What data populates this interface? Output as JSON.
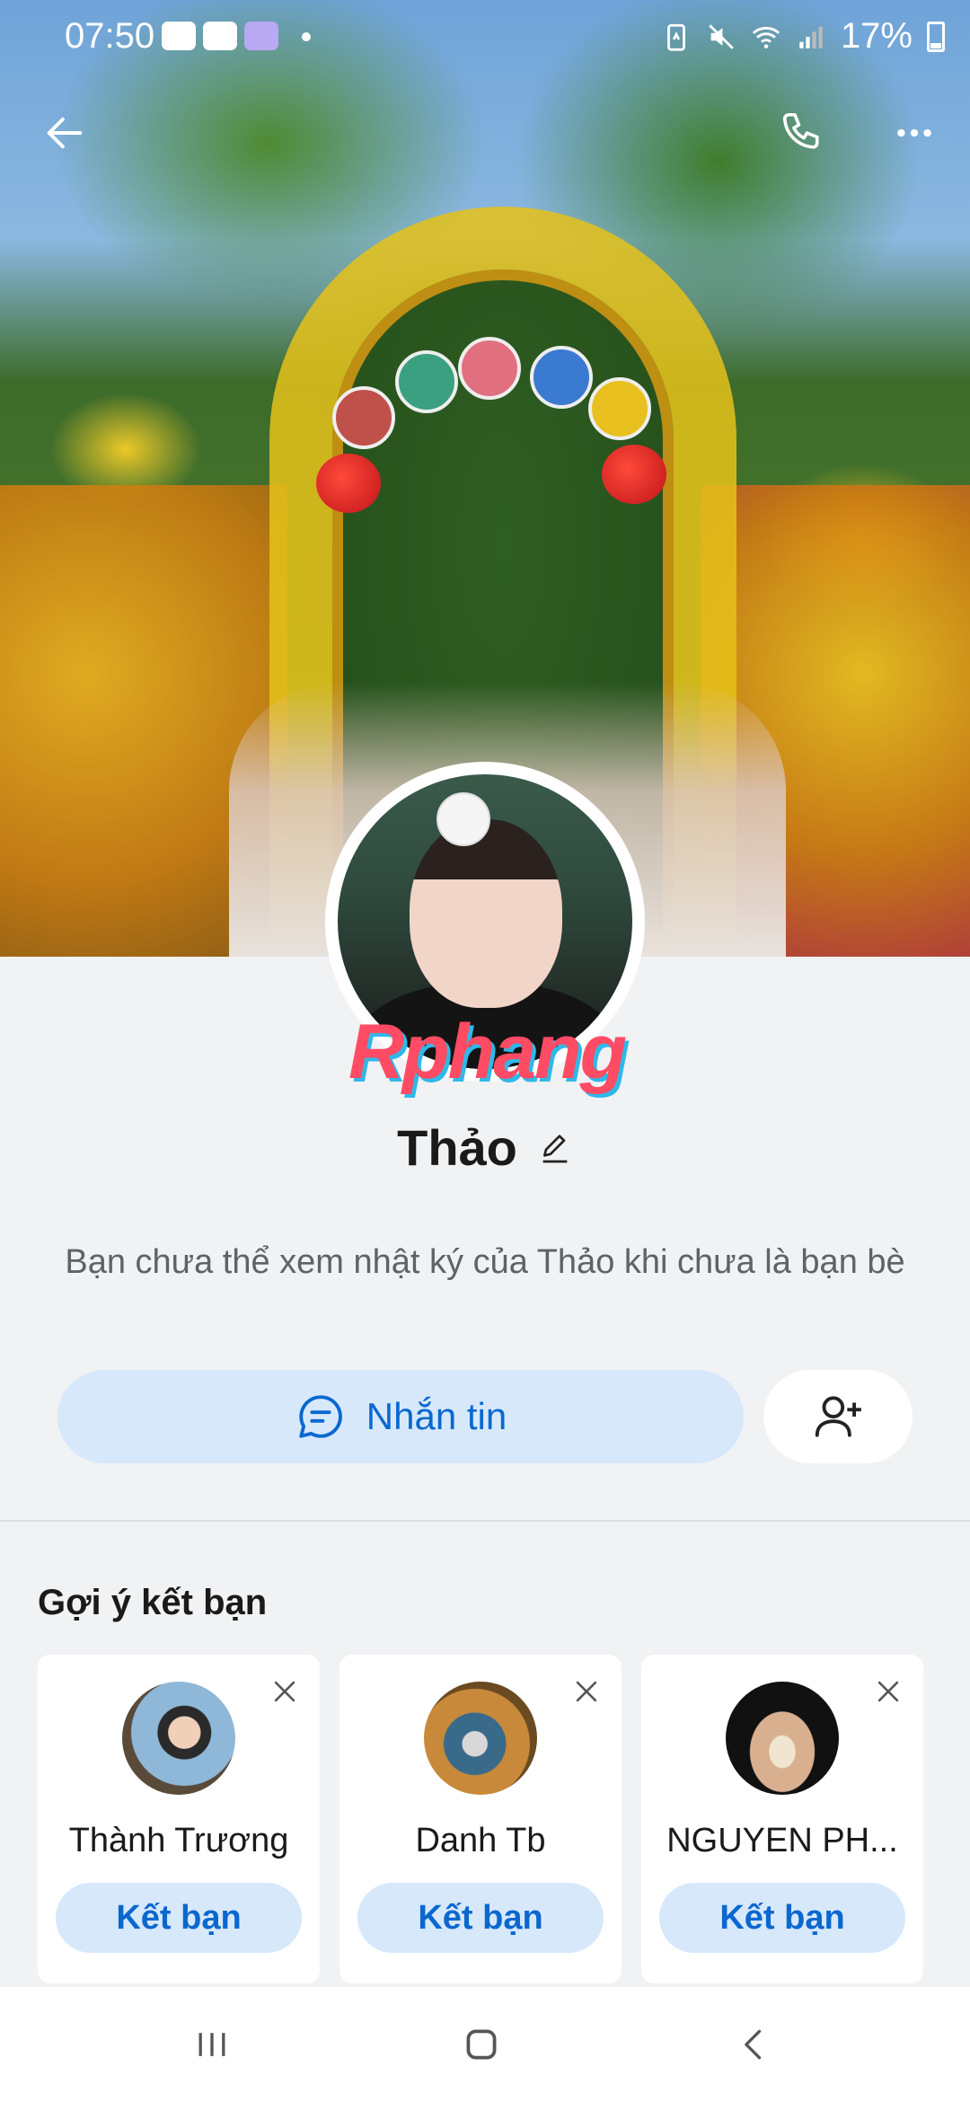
{
  "status_bar": {
    "time": "07:50",
    "battery": "17%",
    "icons": [
      "youtube-icon",
      "youtube-icon",
      "app-icon",
      "battery-saver-icon",
      "mute-icon",
      "wifi-icon",
      "signal-icon",
      "battery-icon"
    ]
  },
  "profile": {
    "name": "Thảo",
    "watermark": "Rphang",
    "privacy_note": "Bạn chưa thể xem nhật ký của Thảo khi chưa là bạn bè",
    "message_label": "Nhắn tin"
  },
  "suggestions": {
    "title": "Gợi ý kết bạn",
    "items": [
      {
        "name": "Thành Trương",
        "action": "Kết bạn"
      },
      {
        "name": "Danh Tb",
        "action": "Kết bạn"
      },
      {
        "name": "NGUYEN PH...",
        "action": "Kết bạn"
      }
    ]
  },
  "colors": {
    "accent": "#0a68cf",
    "accent_light": "#d7e8fb",
    "background": "#f1f2f4"
  }
}
